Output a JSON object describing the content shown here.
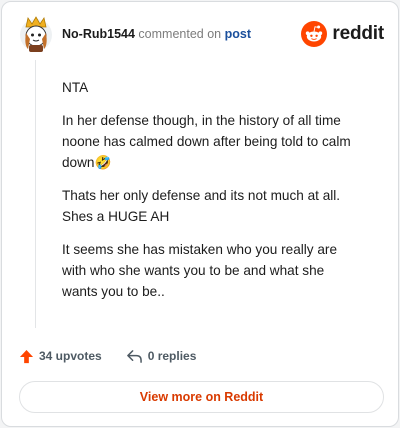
{
  "header": {
    "username": "No-Rub1544",
    "action_text": "commented on",
    "post_link": "post",
    "logo_text": "reddit"
  },
  "comment": {
    "paragraphs": [
      "NTA",
      "In her defense though, in the history of all time noone has calmed down after being told to calm down🤣",
      "Thats her only defense and its not much at all. Shes a HUGE AH",
      "It seems she has mistaken who you really are with who she wants you to be and what she wants you to be.."
    ]
  },
  "actions": {
    "upvotes": "34 upvotes",
    "replies": "0 replies"
  },
  "cta": {
    "label": "View more on Reddit"
  },
  "colors": {
    "brand": "#ff4500",
    "cta_text": "#d93a00",
    "link": "#1a4f9c"
  },
  "icons": [
    "avatar",
    "reddit-logo-icon",
    "upvote-icon",
    "reply-icon"
  ]
}
